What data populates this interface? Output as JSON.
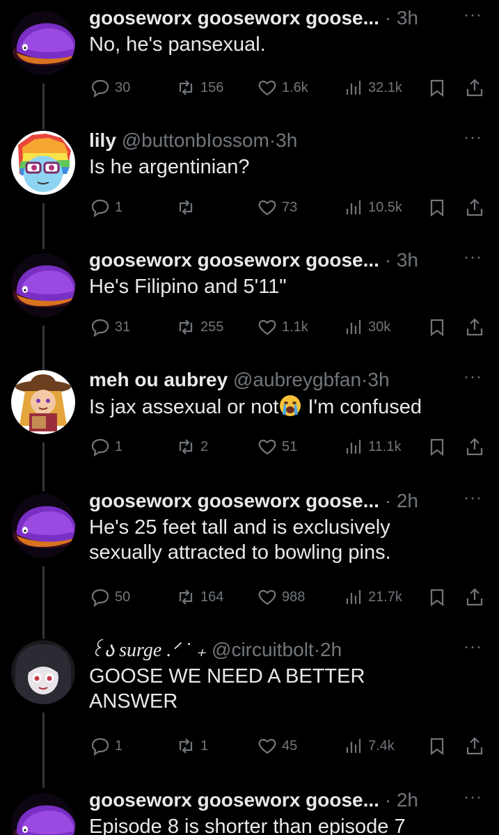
{
  "tweets": [
    {
      "name": "gooseworx gooseworx goose...",
      "handle": "",
      "time": "3h",
      "text": "No, he's pansexual.",
      "replies": "30",
      "retweets": "156",
      "likes": "1.6k",
      "views": "32.1k",
      "avatar": "purple-goose-avatar"
    },
    {
      "name": "lily",
      "handle": "@buttonbIossom",
      "time": "3h",
      "text": "Is he argentinian?",
      "replies": "1",
      "retweets": "",
      "likes": "73",
      "views": "10.5k",
      "avatar": "rainbow-pony-avatar"
    },
    {
      "name": "gooseworx gooseworx goose...",
      "handle": "",
      "time": "3h",
      "text": "He's Filipino and 5'11\"",
      "replies": "31",
      "retweets": "255",
      "likes": "1.1k",
      "views": "30k",
      "avatar": "purple-goose-avatar"
    },
    {
      "name": "meh ou aubrey",
      "handle": "@aubreygbfan",
      "time": "3h",
      "text_before": "Is jax assexual or not",
      "text_after": " I'm confused",
      "emoji": "loudly-crying-face",
      "replies": "1",
      "retweets": "2",
      "likes": "51",
      "views": "11.1k",
      "avatar": "cowboy-girl-avatar"
    },
    {
      "name": "gooseworx gooseworx goose...",
      "handle": "",
      "time": "2h",
      "text": "He's 25 feet tall and is exclusively sexually attracted to bowling pins.",
      "replies": "50",
      "retweets": "164",
      "likes": "988",
      "views": "21.7k",
      "avatar": "purple-goose-avatar"
    },
    {
      "name": "꒰ა surge .ᐟ ˙ ₊",
      "handle": "@circuitbolt",
      "time": "2h",
      "text": "GOOSE WE NEED A BETTER ANSWER",
      "replies": "1",
      "retweets": "1",
      "likes": "45",
      "views": "7.4k",
      "avatar": "anime-girl-avatar"
    },
    {
      "name": "gooseworx gooseworx goose...",
      "handle": "",
      "time": "2h",
      "text": "Episode 8 is shorter than episode 7",
      "avatar": "purple-goose-avatar"
    }
  ],
  "ui": {
    "dot": "·",
    "more": "···"
  },
  "colors": {
    "background": "#000000",
    "text": "#e7e9ea",
    "muted": "#71767b",
    "thread_line": "#333639"
  }
}
